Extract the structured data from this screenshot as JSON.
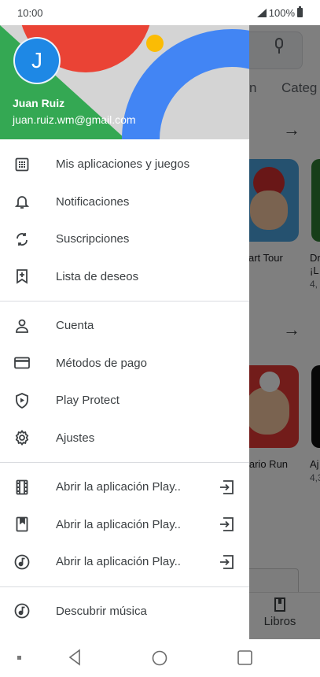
{
  "status_bar": {
    "time": "10:00",
    "battery": "100%"
  },
  "account": {
    "initial": "J",
    "name": "Juan Ruiz",
    "email": "juan.ruiz.wm@gmail.com"
  },
  "menu": {
    "group1": [
      {
        "label": "Mis aplicaciones y juegos",
        "icon": "apps-grid-icon"
      },
      {
        "label": "Notificaciones",
        "icon": "bell-icon"
      },
      {
        "label": "Suscripciones",
        "icon": "refresh-icon"
      },
      {
        "label": "Lista de deseos",
        "icon": "bookmark-plus-icon"
      }
    ],
    "group2": [
      {
        "label": "Cuenta",
        "icon": "person-icon"
      },
      {
        "label": "Métodos de pago",
        "icon": "credit-card-icon"
      },
      {
        "label": "Play Protect",
        "icon": "shield-play-icon"
      },
      {
        "label": "Ajustes",
        "icon": "gear-icon"
      }
    ],
    "group3": [
      {
        "label": "Abrir la aplicación Play..",
        "icon": "film-icon",
        "trailing": "open-external-icon"
      },
      {
        "label": "Abrir la aplicación Play..",
        "icon": "book-icon",
        "trailing": "open-external-icon"
      },
      {
        "label": "Abrir la aplicación Play..",
        "icon": "music-note-icon",
        "trailing": "open-external-icon"
      }
    ],
    "group4": [
      {
        "label": "Descubrir música",
        "icon": "music-note-icon"
      }
    ]
  },
  "background": {
    "tab_partial_1": "n",
    "tab_partial_2": "Categ",
    "card1_title": "art Tour",
    "card2_title_line1": "Dr",
    "card2_title_line2": "¡L",
    "card2_rating": "4,",
    "card3_title": "lario Run",
    "card4_title": "Aj",
    "card4_rating": "4,3",
    "bottom_nav_label": "Libros"
  },
  "colors": {
    "google_red": "#ea4335",
    "google_green": "#34a853",
    "google_blue": "#4285f4",
    "google_yellow": "#fbbc04",
    "avatar_blue": "#1e88e5"
  }
}
